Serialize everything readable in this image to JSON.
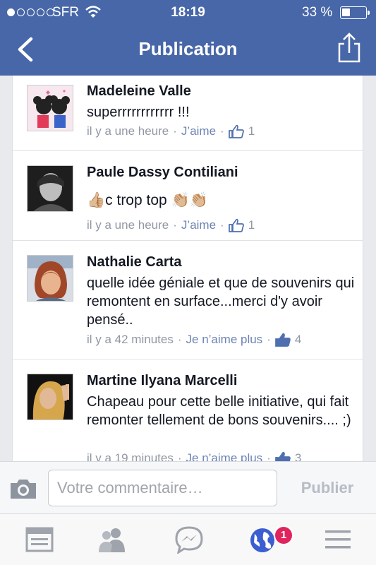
{
  "status_bar": {
    "carrier": "SFR",
    "time": "18:19",
    "battery": "33 %",
    "battery_level": 0.33,
    "signal_bars": 1,
    "signal_total": 5
  },
  "nav": {
    "title": "Publication",
    "back_icon": "chevron-left-icon",
    "share_icon": "share-icon"
  },
  "comments": [
    {
      "author": "Madeleine Valle",
      "text": "superrrrrrrrrrrr !!!",
      "time": "il y a une heure",
      "like_label": "J’aime",
      "likes": "1"
    },
    {
      "author": "Paule Dassy Contiliani",
      "text": "👍🏼c trop top 👏🏼👏🏼",
      "time": "il y a une heure",
      "like_label": "J’aime",
      "likes": "1"
    },
    {
      "author": "Nathalie Carta",
      "text": "quelle idée géniale et que de souvenirs qui remontent en surface...merci d'y avoir pensé..",
      "time": "il y a 42 minutes",
      "like_label": "Je n’aime plus",
      "likes": "4"
    },
    {
      "author": "Martine Ilyana Marcelli",
      "text": "Chapeau pour cette belle initiative, qui fait remonter tellement de bons souvenirs.... ;)",
      "time": "il y a 19 minutes",
      "like_label": "Je n’aime plus",
      "likes": "3"
    }
  ],
  "composer": {
    "placeholder": "Votre commentaire…",
    "publish_label": "Publier"
  },
  "tabbar": {
    "notifications_badge": "1",
    "tabs": [
      "news-feed-icon",
      "friends-icon",
      "messenger-icon",
      "globe-icon",
      "menu-icon"
    ]
  },
  "colors": {
    "brand_blue": "#4767a8",
    "link_blue": "#6d84b4",
    "badge_red": "#e0245e"
  }
}
